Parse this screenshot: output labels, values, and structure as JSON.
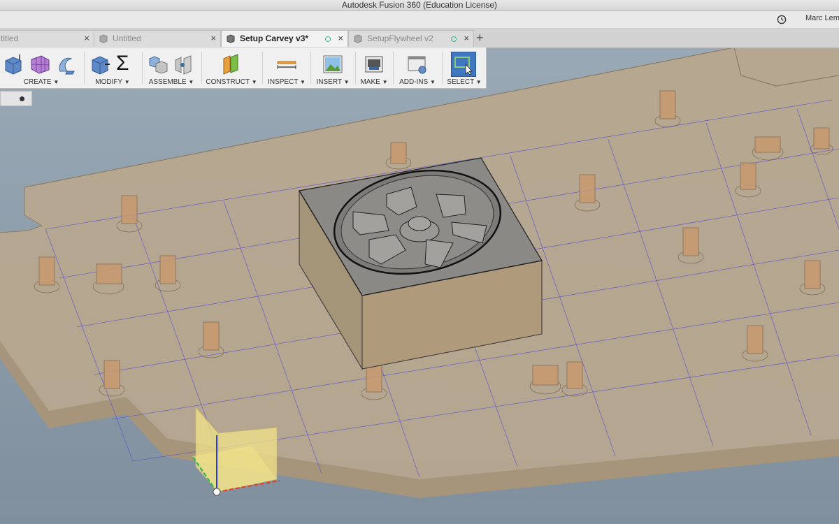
{
  "window": {
    "title": "Autodesk Fusion 360 (Education License)"
  },
  "user": {
    "name": "Marc Lem",
    "clock_icon": "clock-icon"
  },
  "tabs": [
    {
      "label": "titled",
      "active": false,
      "modified": false,
      "close": "×"
    },
    {
      "label": "Untitled",
      "active": false,
      "modified": false,
      "close": "×"
    },
    {
      "label": "Setup Carvey v3*",
      "active": true,
      "modified": true,
      "close": "×"
    },
    {
      "label": "SetupFlywheel v2",
      "active": false,
      "modified": true,
      "close": "×"
    }
  ],
  "add_tab": "+",
  "toolbar": {
    "groups": [
      {
        "label": "CREATE",
        "caret": "▼",
        "icons": [
          "box-extrude-icon",
          "form-grid-icon",
          "sweep-icon"
        ]
      },
      {
        "label": "MODIFY",
        "caret": "▼",
        "icons": [
          "press-pull-icon",
          "sigma-icon"
        ],
        "sigma": "Σ"
      },
      {
        "label": "ASSEMBLE",
        "caret": "▼",
        "icons": [
          "new-component-icon",
          "joint-icon"
        ]
      },
      {
        "label": "CONSTRUCT",
        "caret": "▼",
        "icons": [
          "plane-icon"
        ]
      },
      {
        "label": "INSPECT",
        "caret": "▼",
        "icons": [
          "measure-icon"
        ]
      },
      {
        "label": "INSERT",
        "caret": "▼",
        "icons": [
          "image-icon"
        ]
      },
      {
        "label": "MAKE",
        "caret": "▼",
        "icons": [
          "3d-print-icon"
        ]
      },
      {
        "label": "ADD-INS",
        "caret": "▼",
        "icons": [
          "scripts-icon"
        ]
      },
      {
        "label": "SELECT",
        "caret": "▼",
        "icons": [
          "select-window-icon"
        ]
      }
    ]
  },
  "colors": {
    "viewport_bg": "#8a9aa8",
    "plate": "#b6a48c",
    "block": "#8f8c86",
    "grid": "#5a4fd0",
    "axis_x": "#e23a2a",
    "axis_y": "#2bb24a",
    "axis_z": "#2a3ce2"
  }
}
